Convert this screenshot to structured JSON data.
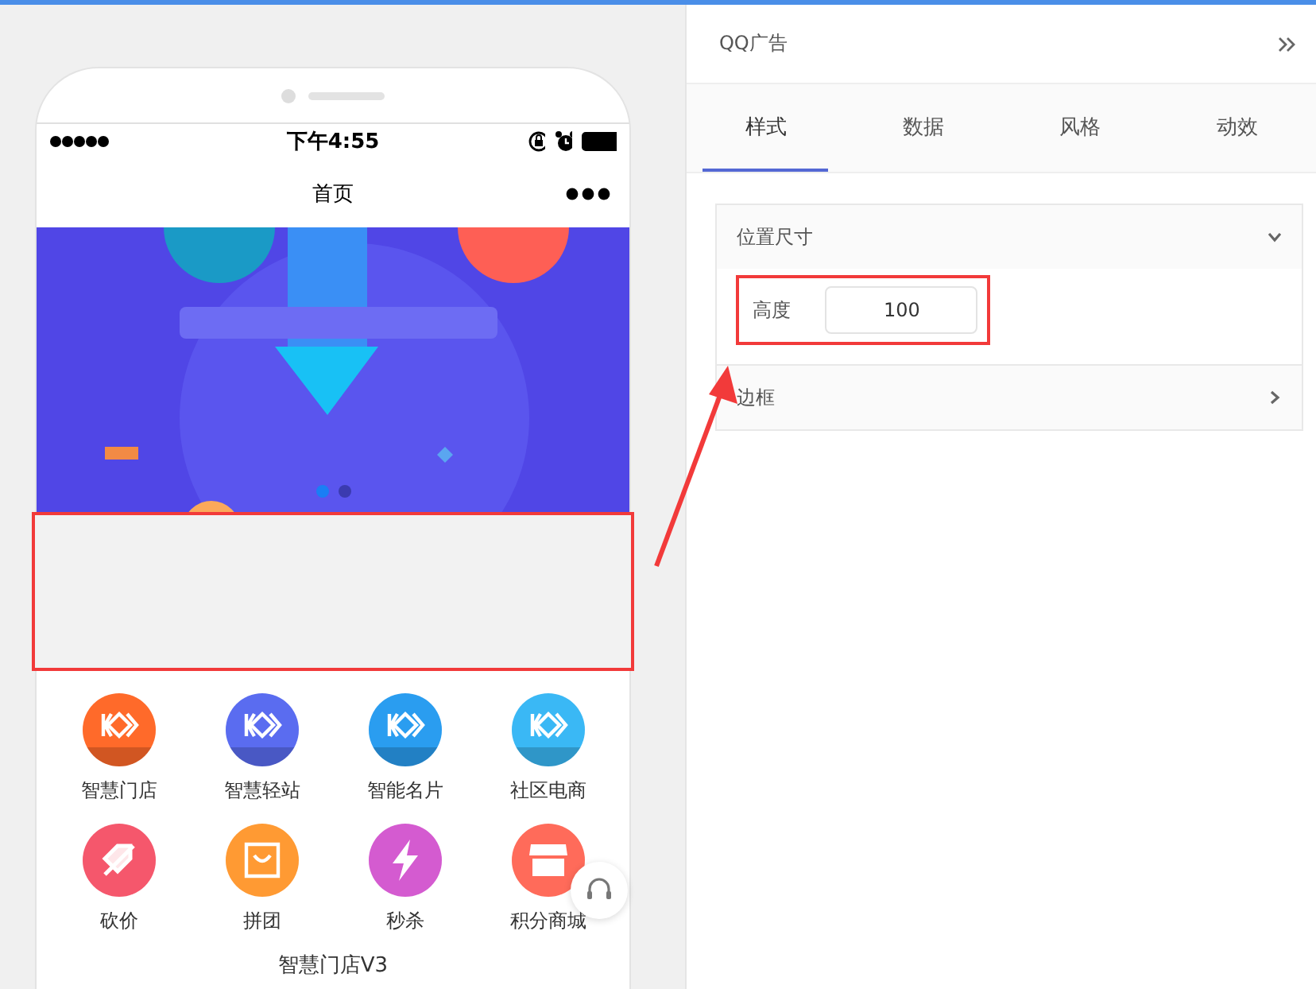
{
  "phone": {
    "status_bar": {
      "time": "下午4:55"
    },
    "nav_title": "首页",
    "banner": {
      "dots": [
        {
          "selected": true
        },
        {
          "selected": false
        }
      ]
    },
    "shortcuts": [
      {
        "label": "智慧门店",
        "kind": "logo",
        "color": "#ff6a2a"
      },
      {
        "label": "智慧轻站",
        "kind": "logo",
        "color": "#5a6cf0"
      },
      {
        "label": "智能名片",
        "kind": "logo",
        "color": "#2a9df0"
      },
      {
        "label": "社区电商",
        "kind": "logo",
        "color": "#3ab8f5"
      },
      {
        "label": "砍价",
        "kind": "tag",
        "color": "#f5576c"
      },
      {
        "label": "拼团",
        "kind": "bag",
        "color": "#ff9a33"
      },
      {
        "label": "秒杀",
        "kind": "bolt",
        "color": "#d45bd0"
      },
      {
        "label": "积分商城",
        "kind": "store",
        "color": "#ff6b5a"
      }
    ],
    "section_heading": "智慧门店V3"
  },
  "panel": {
    "title": "QQ广告",
    "tabs": [
      {
        "label": "样式",
        "selected": true
      },
      {
        "label": "数据",
        "selected": false
      },
      {
        "label": "风格",
        "selected": false
      },
      {
        "label": "动效",
        "selected": false
      }
    ],
    "sections": [
      {
        "title": "位置尺寸",
        "expanded": true,
        "fields": [
          {
            "label": "高度",
            "value": "100"
          }
        ]
      },
      {
        "title": "边框",
        "expanded": false
      }
    ]
  }
}
